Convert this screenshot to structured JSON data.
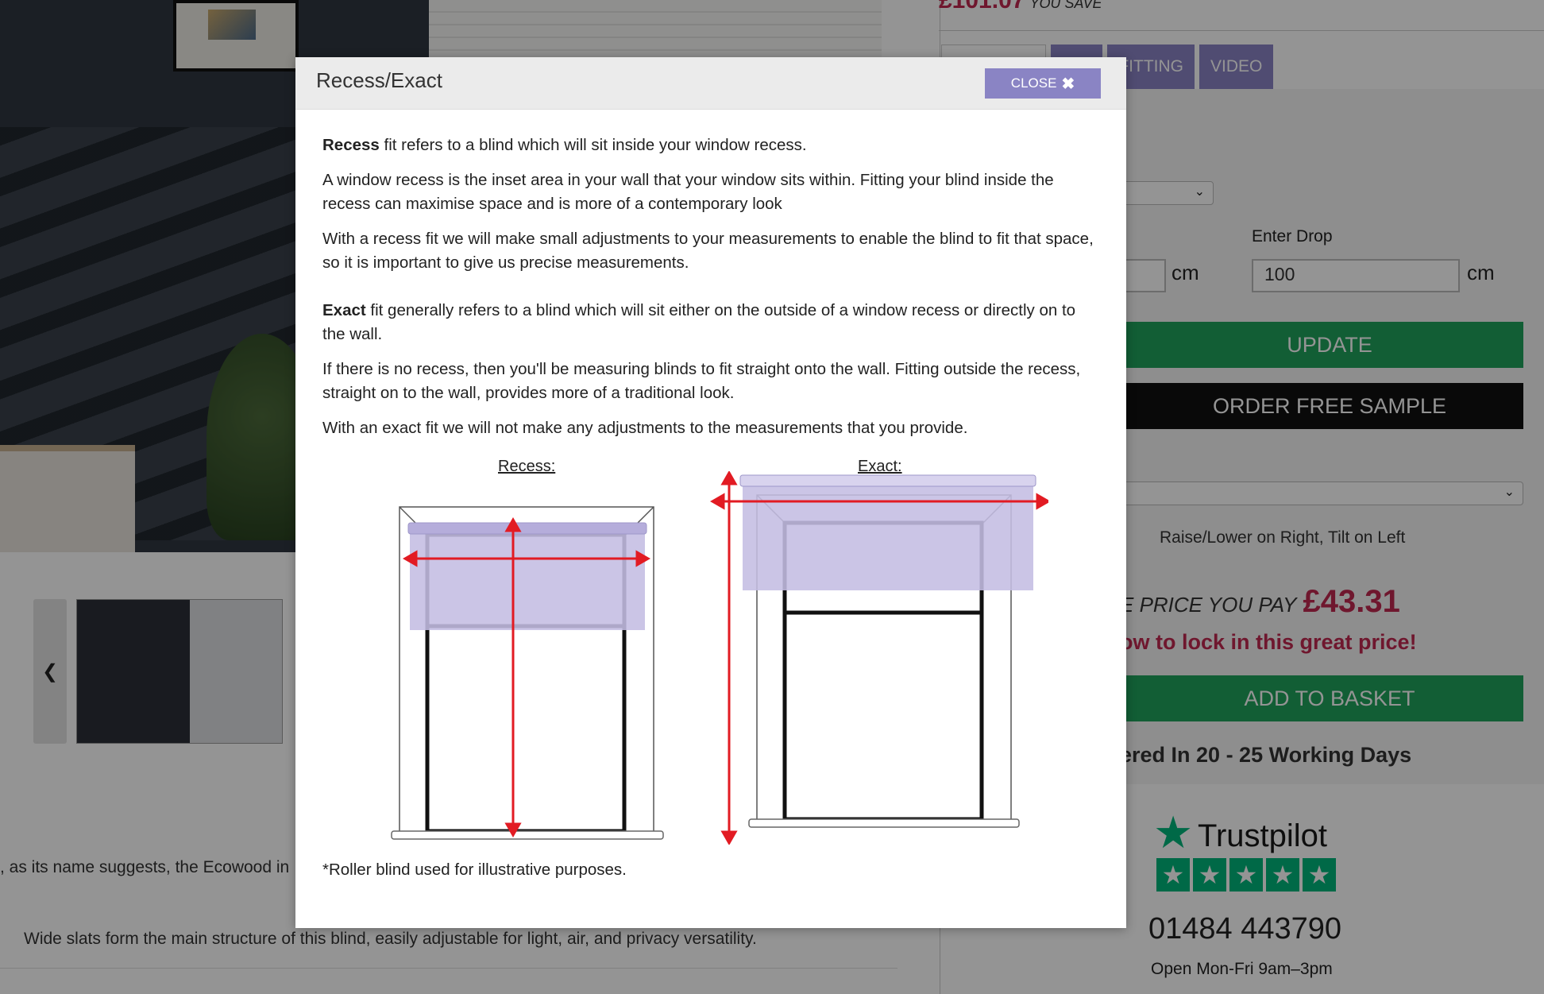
{
  "background": {
    "price_top": "£101.07",
    "you_save": "YOU SAVE",
    "tabs": [
      "",
      "ING",
      "FITTING",
      "VIDEO"
    ],
    "enter_drop_label": "Enter Drop",
    "drop_value": "100",
    "unit_cm": "cm",
    "update_label": "UPDATE",
    "sample_label": "ORDER FREE SAMPLE",
    "control_option": "Raise/Lower on Right, Tilt on Left",
    "price_you_pay_label": "E PRICE YOU PAY",
    "price_you_pay_value": "£43.31",
    "lock_price_text": "ow to lock in this great price!",
    "basket_label": "ADD TO BASKET",
    "delivery_text": "ered In 20 - 25 Working Days",
    "trustpilot": "Trustpilot",
    "phone": "01484 443790",
    "hours": "Open Mon-Fri 9am–3pm",
    "description_line1": ", as its name suggests, the Ecowood in",
    "description_line2": "Wide slats form the main structure of this blind, easily adjustable for light, air, and privacy versatility."
  },
  "modal": {
    "title": "Recess/Exact",
    "close_label": "CLOSE",
    "recess_bold": "Recess",
    "recess_p1_rest": " fit refers to a blind which will sit inside your window recess.",
    "recess_p2": "A window recess is the inset area in your wall that your window sits within. Fitting your blind inside the recess can maximise space and is more of a contemporary look",
    "recess_p3": "With a recess fit we will make small adjustments to your measurements to enable the blind to fit that space, so it is important to give us precise measurements.",
    "exact_bold": "Exact",
    "exact_p1_rest": " fit generally refers to a blind which will sit either on the outside of a window recess or directly on to the wall.",
    "exact_p2": "If there is no recess, then you'll be measuring blinds to fit straight onto the wall. Fitting outside the recess, straight on to the wall, provides more of a traditional look.",
    "exact_p3": "With an exact fit we will not make any adjustments to the measurements that you provide.",
    "caption_recess": "Recess:",
    "caption_exact": "Exact:",
    "footnote": "*Roller blind used for illustrative purposes."
  },
  "colors": {
    "accent": "#8a84c4",
    "blind": "#c4bde3",
    "arrow": "#e21b23",
    "green": "#1fa35c",
    "price": "#c02850"
  }
}
